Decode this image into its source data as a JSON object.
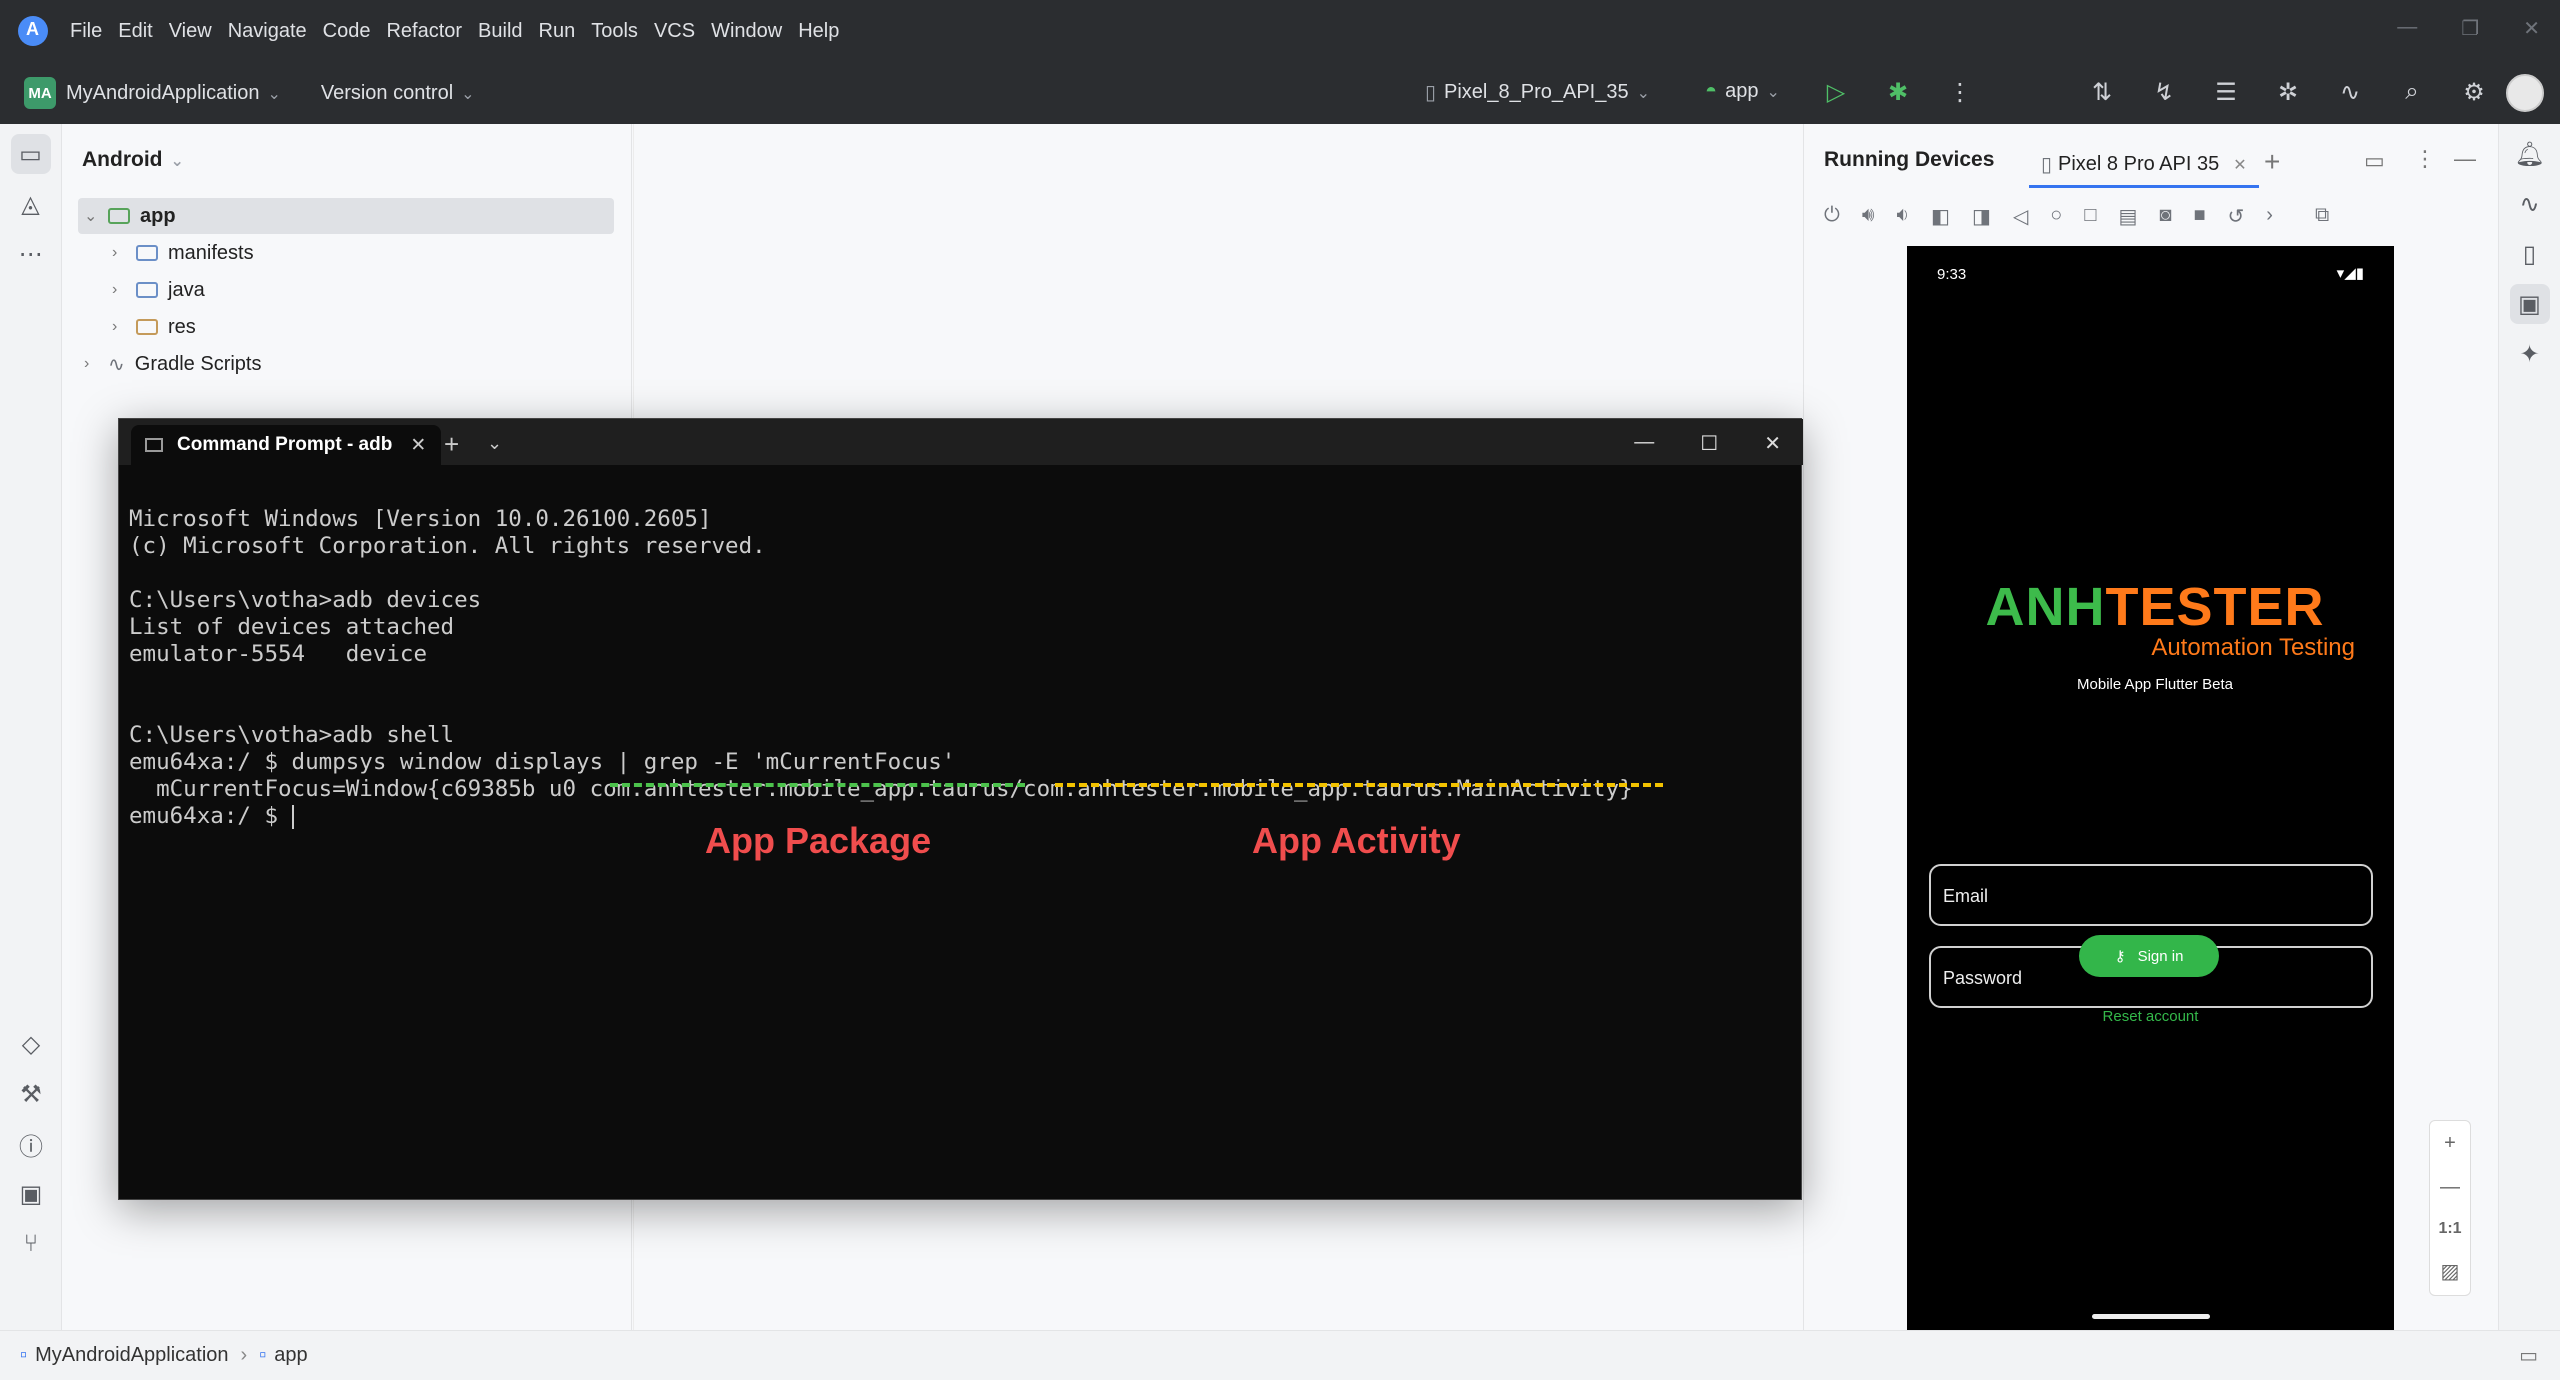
{
  "menubar": {
    "items": [
      "File",
      "Edit",
      "View",
      "Navigate",
      "Code",
      "Refactor",
      "Build",
      "Run",
      "Tools",
      "VCS",
      "Window",
      "Help"
    ]
  },
  "toolbar": {
    "project_badge": "MA",
    "project_name": "MyAndroidApplication",
    "version_control": "Version control",
    "device": "Pixel_8_Pro_API_35",
    "run_config": "app"
  },
  "project_panel": {
    "title": "Android",
    "tree": [
      {
        "label": "app",
        "level": 0
      },
      {
        "label": "manifests",
        "level": 1
      },
      {
        "label": "java",
        "level": 1
      },
      {
        "label": "res",
        "level": 1
      },
      {
        "label": "Gradle Scripts",
        "level": 0
      }
    ]
  },
  "device_panel": {
    "title": "Running Devices",
    "tab": "Pixel 8 Pro API 35"
  },
  "phone": {
    "time": "9:33",
    "logo_part1": "ANH",
    "logo_part2": "TESTER",
    "logo_subtitle": "Automation Testing",
    "tagline": "Mobile App Flutter Beta",
    "email_placeholder": "Email",
    "password_placeholder": "Password",
    "signin_label": "Sign in",
    "reset_label": "Reset account"
  },
  "zoom": {
    "one_to_one": "1:1"
  },
  "cmd": {
    "tab_title": "Command Prompt - adb",
    "lines": [
      "Microsoft Windows [Version 10.0.26100.2605]",
      "(c) Microsoft Corporation. All rights reserved.",
      "",
      "C:\\Users\\votha>adb devices",
      "List of devices attached",
      "emulator-5554   device",
      "",
      "",
      "C:\\Users\\votha>adb shell",
      "emu64xa:/ $ dumpsys window displays | grep -E 'mCurrentFocus'",
      "  mCurrentFocus=Window{c69385b u0 com.anhtester.mobile_app.taurus/com.anhtester.mobile_app.taurus.MainActivity}",
      "emu64xa:/ $ "
    ]
  },
  "annotations": {
    "package_label": "App Package",
    "activity_label": "App Activity",
    "package_color": "#4cc24c",
    "activity_color": "#f2c200",
    "label_color": "#f04d4d"
  },
  "footer": {
    "crumb1": "MyAndroidApplication",
    "crumb2": "app"
  }
}
